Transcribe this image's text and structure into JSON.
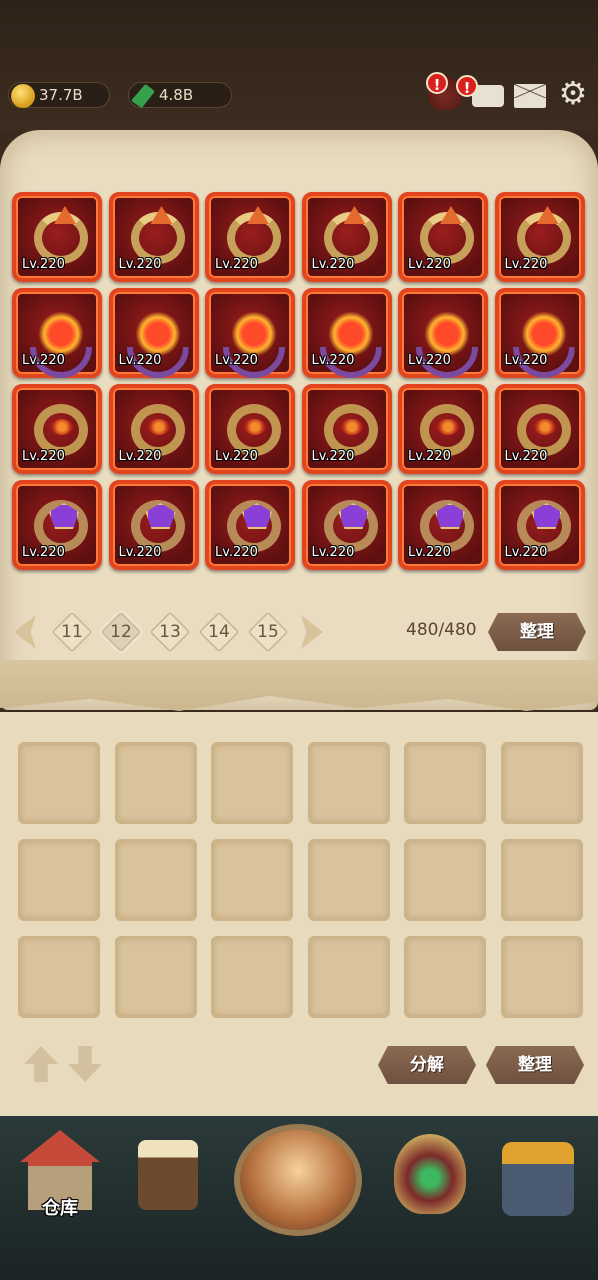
{
  "resources": {
    "gold": {
      "value": "37.7B",
      "icon": "gold-coin-icon"
    },
    "gem": {
      "value": "4.8B",
      "icon": "green-gem-icon"
    }
  },
  "top_icons": [
    {
      "name": "bag-icon",
      "alert": "!"
    },
    {
      "name": "chat-icon",
      "alert": "!"
    },
    {
      "name": "mail-icon"
    },
    {
      "name": "gear-icon"
    }
  ],
  "inventory": {
    "rows": [
      {
        "type": "ring-a",
        "items": [
          "Lv.220",
          "Lv.220",
          "Lv.220",
          "Lv.220",
          "Lv.220",
          "Lv.220"
        ]
      },
      {
        "type": "ring-b",
        "items": [
          "Lv.220",
          "Lv.220",
          "Lv.220",
          "Lv.220",
          "Lv.220",
          "Lv.220"
        ]
      },
      {
        "type": "ring-c",
        "items": [
          "Lv.220",
          "Lv.220",
          "Lv.220",
          "Lv.220",
          "Lv.220",
          "Lv.220"
        ]
      },
      {
        "type": "ring-d",
        "items": [
          "Lv.220",
          "Lv.220",
          "Lv.220",
          "Lv.220",
          "Lv.220",
          "Lv.220"
        ]
      }
    ]
  },
  "pager": {
    "pages": [
      "11",
      "12",
      "13",
      "14",
      "15"
    ],
    "active": "12",
    "count": "480/480",
    "sort_label": "整理"
  },
  "slots_count": 18,
  "actions": {
    "decompose_label": "分解",
    "sort_label": "整理"
  },
  "bottom_nav": {
    "warehouse_label": "仓库"
  }
}
